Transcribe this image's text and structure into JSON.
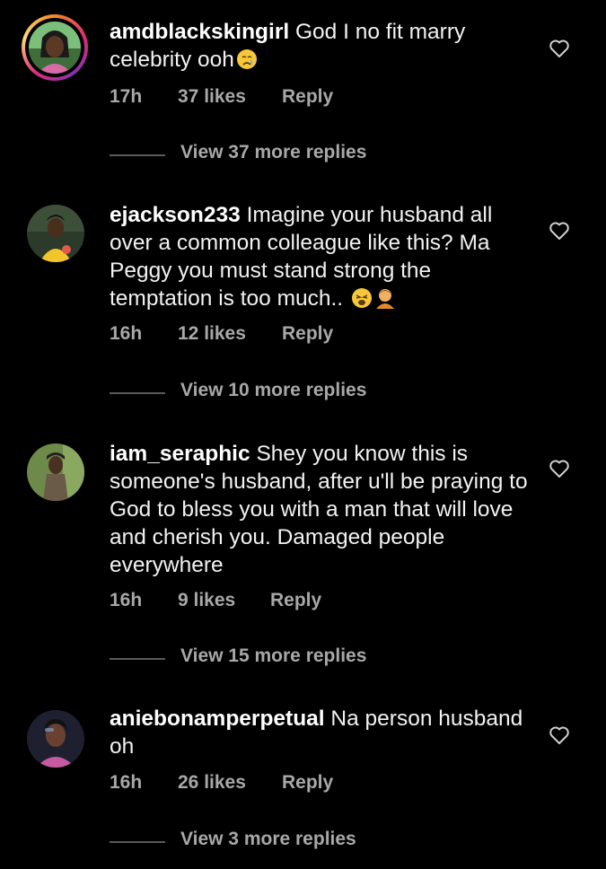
{
  "icons": {
    "like": "heart-outline-icon"
  },
  "colors": {
    "background": "#000000",
    "text": "#f2f2f2",
    "secondary_text": "#a8a8a8",
    "story_ring": [
      "#f58529",
      "#dd2a7b",
      "#8134af"
    ]
  },
  "comments": [
    {
      "username": "amdblackskingirl",
      "text": "God I no fit marry celebrity ooh",
      "emojis": [
        "crying-face-emoji"
      ],
      "time": "17h",
      "likes": "37 likes",
      "reply": "Reply",
      "view_replies": "View 37 more replies"
    },
    {
      "username": "ejackson233",
      "text": "Imagine your husband all over a common colleague like this? Ma Peggy you must stand strong the temptation is too much.. ",
      "emojis": [
        "weary-face-emoji",
        "person-facepalming-emoji"
      ],
      "time": "16h",
      "likes": "12 likes",
      "reply": "Reply",
      "view_replies": "View 10 more replies"
    },
    {
      "username": "iam_seraphic",
      "text": "Shey you know this is someone's husband, after u'll be praying to God to bless you with a man that will love and cherish you. Damaged people everywhere",
      "emojis": [],
      "time": "16h",
      "likes": "9 likes",
      "reply": "Reply",
      "view_replies": "View 15 more replies"
    },
    {
      "username": "aniebonamperpetual",
      "text": "Na person husband oh",
      "emojis": [],
      "time": "16h",
      "likes": "26 likes",
      "reply": "Reply",
      "view_replies": "View 3 more replies"
    }
  ]
}
